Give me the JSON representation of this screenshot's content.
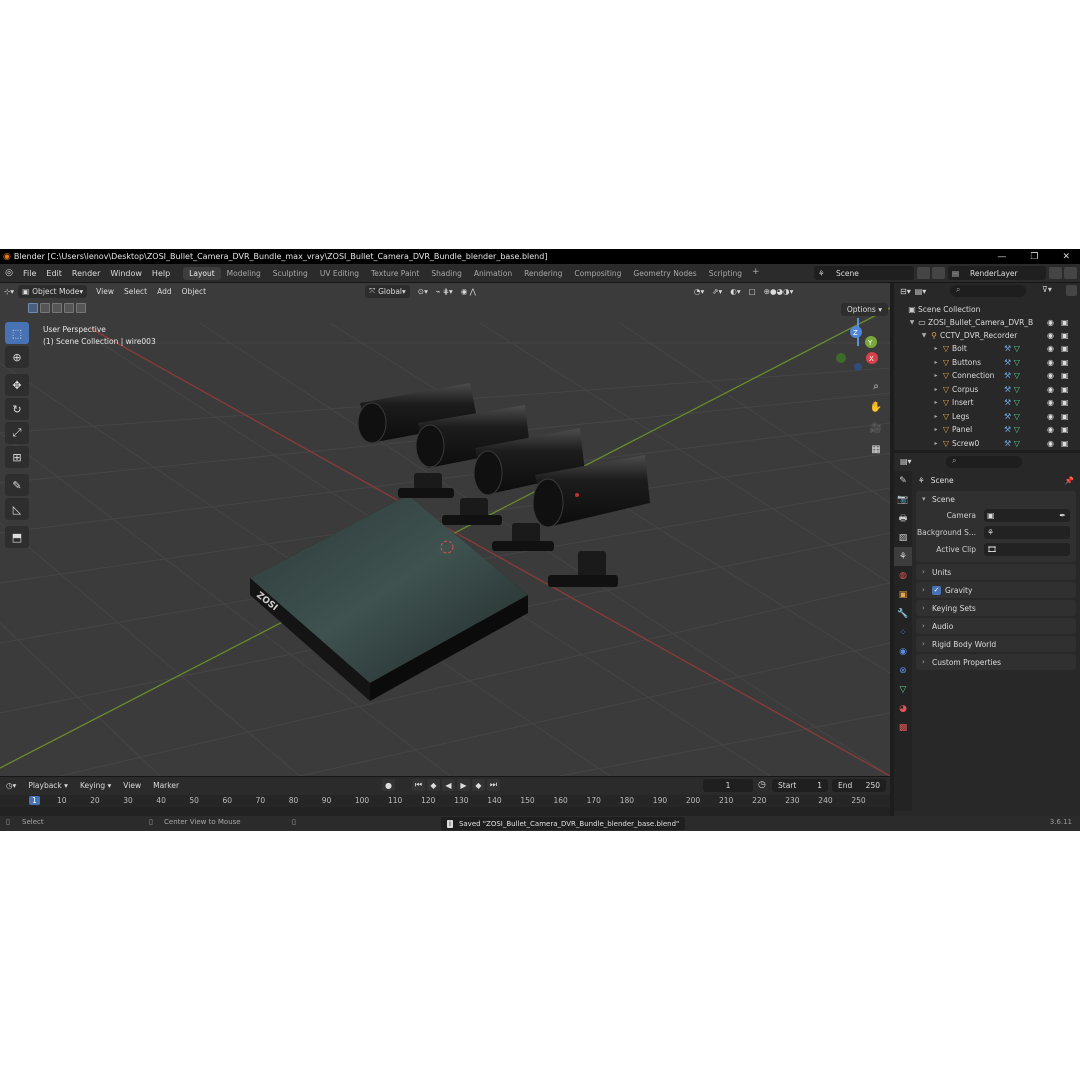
{
  "window": {
    "title": "Blender [C:\\Users\\lenov\\Desktop\\ZOSI_Bullet_Camera_DVR_Bundle_max_vray\\ZOSI_Bullet_Camera_DVR_Bundle_blender_base.blend]",
    "minimize": "—",
    "restore": "❐",
    "close": "✕"
  },
  "menu": [
    "File",
    "Edit",
    "Render",
    "Window",
    "Help"
  ],
  "workspaces": [
    "Layout",
    "Modeling",
    "Sculpting",
    "UV Editing",
    "Texture Paint",
    "Shading",
    "Animation",
    "Rendering",
    "Compositing",
    "Geometry Nodes",
    "Scripting"
  ],
  "active_workspace": "Layout",
  "scene_name": "Scene",
  "view_layer": "RenderLayer",
  "viewport": {
    "mode": "Object Mode",
    "menus": [
      "View",
      "Select",
      "Add",
      "Object"
    ],
    "transform_orientation": "Global",
    "info_line1": "User Perspective",
    "info_line2": "(1) Scene Collection | wire003",
    "options": "Options",
    "gizmo": {
      "x": "X",
      "y": "Y",
      "z": "Z"
    },
    "dvr_brand": "ZOSI"
  },
  "timeline": {
    "menus": [
      "Playback",
      "Keying",
      "View",
      "Marker"
    ],
    "current_frame": "1",
    "start_label": "Start",
    "start": "1",
    "end_label": "End",
    "end": "250",
    "ruler": [
      "1",
      "10",
      "20",
      "30",
      "40",
      "50",
      "60",
      "70",
      "80",
      "90",
      "100",
      "110",
      "120",
      "130",
      "140",
      "150",
      "160",
      "170",
      "180",
      "190",
      "200",
      "210",
      "220",
      "230",
      "240",
      "250"
    ]
  },
  "status": {
    "select": "Select",
    "center": "Center View to Mouse",
    "saved": "Saved \"ZOSI_Bullet_Camera_DVR_Bundle_blender_base.blend\"",
    "version": "3.6.11"
  },
  "outliner": {
    "root": "Scene Collection",
    "collection": "ZOSI_Bullet_Camera_DVR_B",
    "object": "CCTV_DVR_Recorder",
    "children": [
      "Bolt",
      "Buttons",
      "Connection",
      "Corpus",
      "Insert",
      "Legs",
      "Panel",
      "Screw0"
    ]
  },
  "properties": {
    "title": "Scene",
    "panel_scene": "Scene",
    "camera_label": "Camera",
    "background_label": "Background S...",
    "active_clip_label": "Active Clip",
    "panels": [
      "Units",
      "Gravity",
      "Keying Sets",
      "Audio",
      "Rigid Body World",
      "Custom Properties"
    ]
  }
}
